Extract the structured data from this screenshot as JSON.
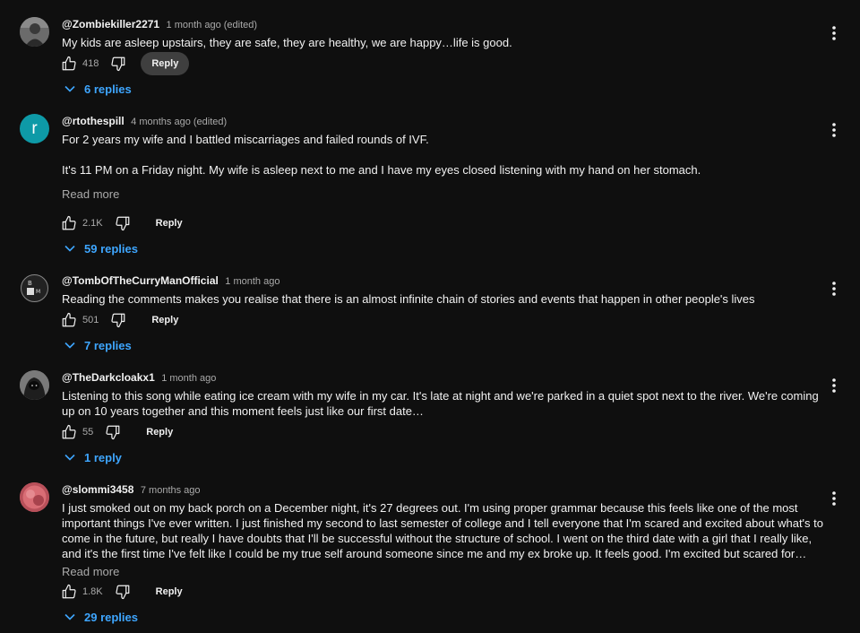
{
  "colors": {
    "background": "#0f0f0f",
    "text": "#f1f1f1",
    "muted": "#aaaaaa",
    "link": "#3ea6ff",
    "reply_hover": "#3f3f3f"
  },
  "comments": [
    {
      "author": "@Zombiekiller2271",
      "time": "1 month ago (edited)",
      "text": "My kids are asleep upstairs, they are safe, they are healthy, we are happy…life is good.",
      "read_more": "",
      "likes": "418",
      "reply_label": "Reply",
      "replies_label": "6 replies",
      "avatar": {
        "type": "image",
        "icon": "person-photo-avatar",
        "color": "#5a5a5a"
      }
    },
    {
      "author": "@rtothespill",
      "time": "4 months ago (edited)",
      "text": "For 2 years my wife and I battled miscarriages and failed rounds of IVF.\n\nIt's 11 PM on a Friday night. My wife is asleep next to me and I have my eyes closed listening with my hand on her stomach.\n…",
      "read_more": "Read more",
      "likes": "2.1K",
      "reply_label": "Reply",
      "replies_label": "59 replies",
      "avatar": {
        "type": "letter",
        "letter": "r",
        "color": "#0e9aa7"
      }
    },
    {
      "author": "@TombOfTheCurryManOfficial",
      "time": "1 month ago",
      "text": "Reading the comments makes you realise that there is an almost infinite chain of stories and events that happen in other people's lives",
      "read_more": "",
      "likes": "501",
      "reply_label": "Reply",
      "replies_label": "7 replies",
      "avatar": {
        "type": "image",
        "icon": "logo-avatar",
        "color": "#1a1a1a"
      }
    },
    {
      "author": "@TheDarkcloakx1",
      "time": "1 month ago",
      "text": "Listening to this song while eating ice cream with my wife in my car. It's late at night and we're parked in a quiet spot next to the river. We're coming up on 10 years together and this moment feels just like our first date…",
      "read_more": "",
      "likes": "55",
      "reply_label": "Reply",
      "replies_label": "1 reply",
      "avatar": {
        "type": "image",
        "icon": "cloaked-figure-avatar",
        "color": "#6a6a6a"
      }
    },
    {
      "author": "@slommi3458",
      "time": "7 months ago",
      "text": "I just smoked out on my back porch on a December night, it's 27 degrees out. I'm using proper grammar because this feels like one of the most important things I've ever written. I just finished my second to last semester of college and I tell everyone that I'm scared and excited about what's to come in the future, but really I have doubts that I'll be successful without the structure of school. I went on the third date with a girl that I really like, and it's the first time I've felt like I could be my true self around someone since me and my ex broke up. It feels good. I'm excited but scared for what's to come, but I think that's how it should be. I'm thankful for …",
      "read_more": "Read more",
      "likes": "1.8K",
      "reply_label": "Reply",
      "replies_label": "29 replies",
      "avatar": {
        "type": "image",
        "icon": "pink-abstract-avatar",
        "color": "#c45a63"
      }
    }
  ]
}
